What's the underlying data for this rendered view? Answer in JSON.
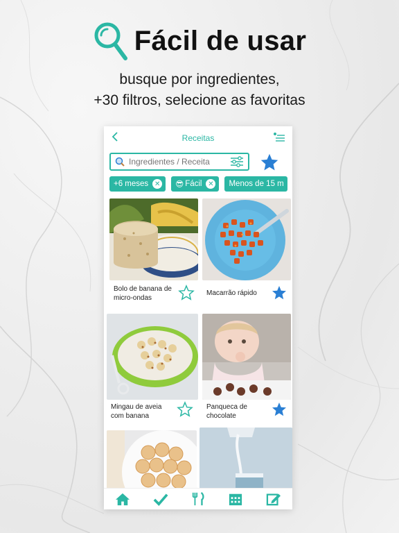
{
  "headline": {
    "title": "Fácil de usar",
    "line1": "busque por ingredientes,",
    "line2": "+30 filtros, selecione as favoritas"
  },
  "app": {
    "screen_title": "Receitas",
    "search_placeholder": "Ingredientes / Receita",
    "chips": [
      {
        "label": "+6 meses",
        "emoji": ""
      },
      {
        "label": "Fácil",
        "emoji": "😎"
      },
      {
        "label": "Menos de 15 m",
        "emoji": ""
      }
    ],
    "recipes": [
      {
        "name": "Bolo de banana de micro-ondas",
        "favorite": false
      },
      {
        "name": "Macarrão rápido",
        "favorite": true
      },
      {
        "name": "Mingau de aveia com banana",
        "favorite": false
      },
      {
        "name": "Panqueca de chocolate",
        "favorite": true
      },
      {
        "name": "",
        "favorite": false
      },
      {
        "name": "",
        "favorite": false
      }
    ],
    "tabs": [
      "home-icon",
      "check-icon",
      "cutlery-icon",
      "calendar-icon",
      "edit-icon"
    ]
  },
  "colors": {
    "accent": "#2bb7a4",
    "star_blue": "#2a7fd4"
  }
}
